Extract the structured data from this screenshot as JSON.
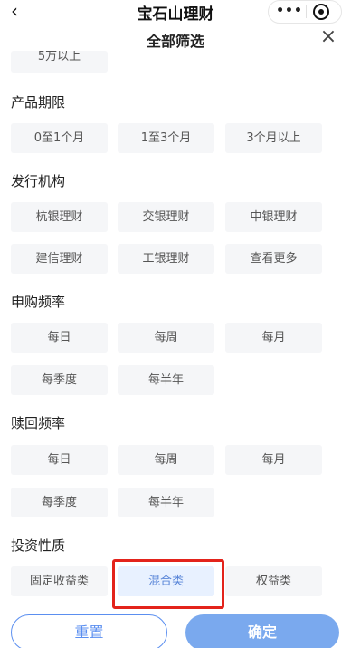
{
  "navbar": {
    "title": "宝石山理财",
    "back_icon": "‹",
    "more_icon": "•••"
  },
  "panel": {
    "title": "全部筛选",
    "close_icon": "×"
  },
  "amount_partial": {
    "option": "5万以上"
  },
  "term": {
    "title": "产品期限",
    "options": [
      "0至1个月",
      "1至3个月",
      "3个月以上"
    ]
  },
  "issuer": {
    "title": "发行机构",
    "options": [
      "杭银理财",
      "交银理财",
      "中银理财",
      "建信理财",
      "工银理财",
      "查看更多"
    ]
  },
  "purchase_freq": {
    "title": "申购频率",
    "options": [
      "每日",
      "每周",
      "每月",
      "每季度",
      "每半年"
    ]
  },
  "redeem_freq": {
    "title": "赎回频率",
    "options": [
      "每日",
      "每周",
      "每月",
      "每季度",
      "每半年"
    ]
  },
  "invest_type": {
    "title": "投资性质",
    "options": [
      "固定收益类",
      "混合类",
      "权益类"
    ],
    "selected": "混合类"
  },
  "footer": {
    "reset_label": "重置",
    "confirm_label": "确定"
  },
  "colors": {
    "accent": "#5b8ff0",
    "confirm_bg": "#7aa9ee",
    "highlight": "#e3231b",
    "chip_bg": "#f5f6f8"
  }
}
